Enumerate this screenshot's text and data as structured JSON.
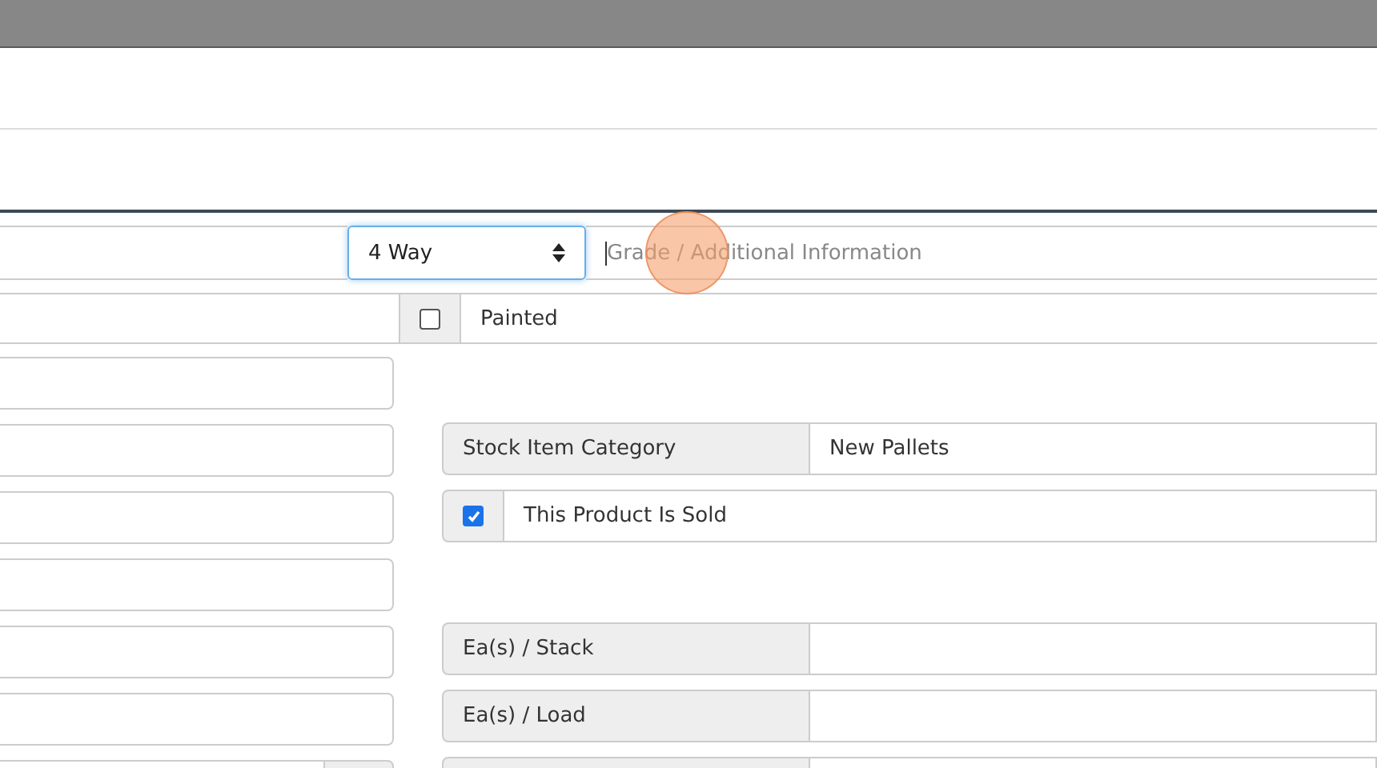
{
  "pallet_row": {
    "type_select": {
      "value": "4 Way"
    },
    "grade_field": {
      "placeholder": "Grade / Additional Information",
      "focused": true
    }
  },
  "painted": {
    "label": "Painted",
    "checked": false
  },
  "right_fields": [
    {
      "kind": "blank"
    },
    {
      "kind": "labeled",
      "label": "Stock Item Category",
      "value": "New Pallets"
    },
    {
      "kind": "checkbox",
      "label": "This Product Is Sold",
      "checked": true
    },
    {
      "kind": "blank"
    },
    {
      "kind": "labeled",
      "label": "Ea(s) / Stack"
    },
    {
      "kind": "labeled",
      "label": "Ea(s) / Load"
    },
    {
      "kind": "labeled"
    }
  ]
}
